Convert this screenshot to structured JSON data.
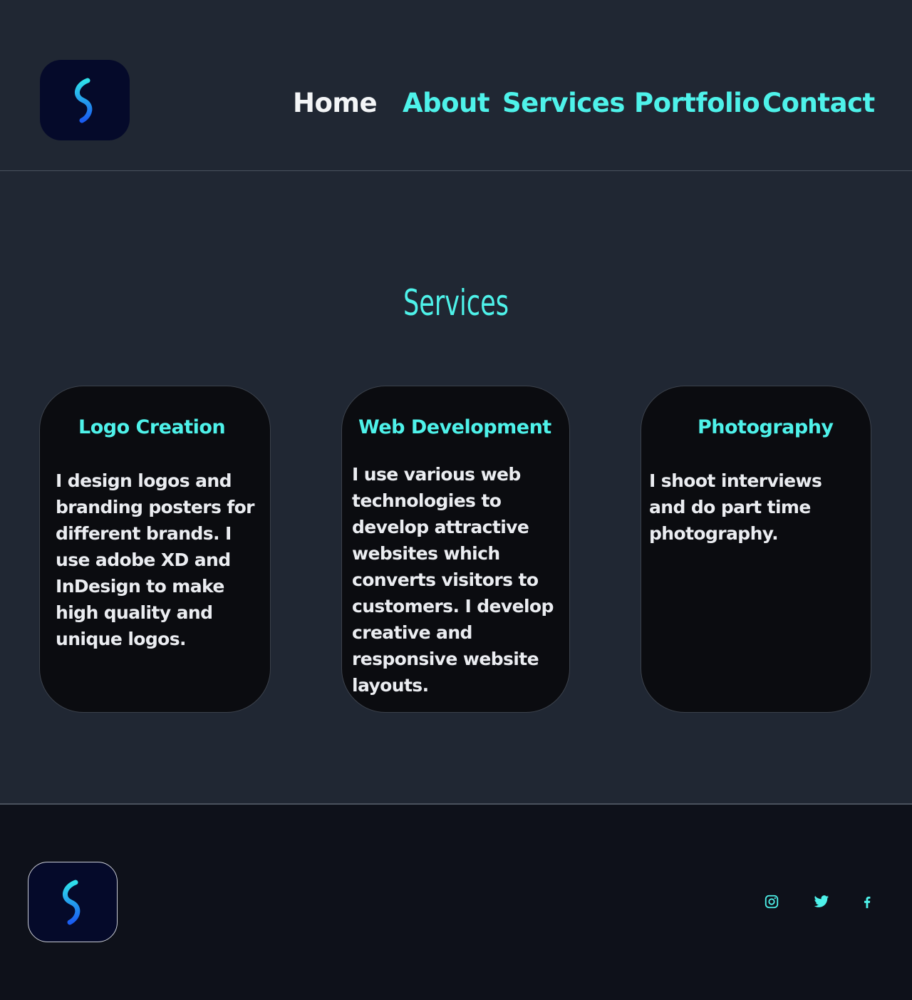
{
  "header": {
    "nav": {
      "home": "Home",
      "about": "About",
      "services": "Services",
      "portfolio": "Portfolio",
      "contact": "Contact"
    }
  },
  "main": {
    "section_title": "Services",
    "cards": [
      {
        "title": "Logo Creation",
        "text": "I design logos and branding posters for different brands. I use adobe XD and InDesign to make high quality and unique logos."
      },
      {
        "title": "Web Development",
        "text": "I use various web technologies to develop attractive websites which converts visitors to customers. I develop creative and responsive website layouts."
      },
      {
        "title": "Photography",
        "text": "I shoot interviews and do part time photography."
      }
    ]
  },
  "footer": {
    "social": [
      "instagram-icon",
      "twitter-icon",
      "facebook-icon"
    ]
  },
  "colors": {
    "background": "#202733",
    "accent": "#4ef2ea",
    "card": "#0b0c10",
    "footer": "#0e111a",
    "logo_bg": "#050a2a",
    "nav_active": "#f3f5f7"
  }
}
